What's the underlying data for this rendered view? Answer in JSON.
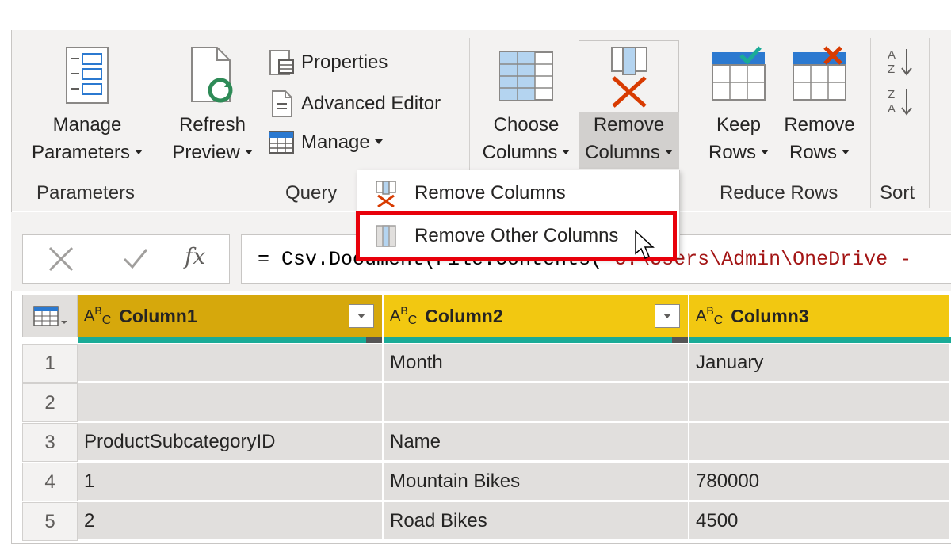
{
  "ribbon": {
    "manage_parameters": {
      "line1": "Manage",
      "line2": "Parameters"
    },
    "refresh_preview": {
      "line1": "Refresh",
      "line2": "Preview"
    },
    "properties": "Properties",
    "advanced_editor": "Advanced Editor",
    "manage": "Manage",
    "choose_columns": {
      "line1": "Choose",
      "line2": "Columns"
    },
    "remove_columns": {
      "line1": "Remove",
      "line2": "Columns"
    },
    "keep_rows": {
      "line1": "Keep",
      "line2": "Rows"
    },
    "remove_rows": {
      "line1": "Remove",
      "line2": "Rows"
    },
    "groups": {
      "parameters": "Parameters",
      "query": "Query",
      "reduce_rows": "Reduce Rows",
      "sort": "Sort"
    }
  },
  "dropdown": {
    "items": [
      {
        "label": "Remove Columns"
      },
      {
        "label": "Remove Other Columns"
      }
    ]
  },
  "formula": {
    "prefix": "= Csv.Document(File.Contents(\"",
    "path": "C:\\Users\\Admin\\OneDrive - "
  },
  "grid": {
    "type_label": "ABC",
    "columns": [
      "Column1",
      "Column2",
      "Column3"
    ],
    "rows": [
      {
        "num": "1",
        "c1": "",
        "c2": "Month",
        "c3": "January"
      },
      {
        "num": "2",
        "c1": "",
        "c2": "",
        "c3": ""
      },
      {
        "num": "3",
        "c1": "ProductSubcategoryID",
        "c2": "Name",
        "c3": ""
      },
      {
        "num": "4",
        "c1": "1",
        "c2": "Mountain Bikes",
        "c3": "780000"
      },
      {
        "num": "5",
        "c1": "2",
        "c2": "Road Bikes",
        "c3": "4500"
      }
    ]
  },
  "colors": {
    "header_yellow": "#f2c811",
    "highlight_red": "#e8000a",
    "quality_teal": "#1aab97",
    "refresh_green": "#2e8b57",
    "remove_red": "#d83b01"
  }
}
